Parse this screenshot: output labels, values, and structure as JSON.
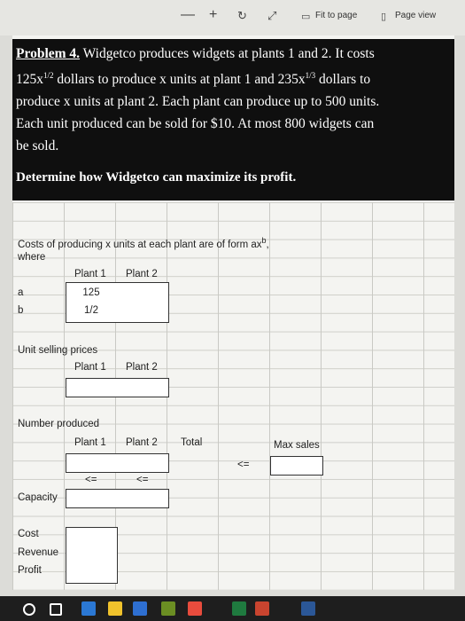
{
  "toolbar": {
    "minus": "—",
    "plus": "+",
    "fit_label": "Fit to page",
    "page_view_label": "Page view"
  },
  "problem": {
    "lead": "Problem 4.",
    "line1": " Widgetco produces widgets at plants 1 and 2. It costs",
    "line2a": "125x",
    "sup1": "1/2",
    "line2b": " dollars to produce x units at plant 1 and 235x",
    "sup2": "1/3",
    "line2c": " dollars to",
    "line3": "produce x units at plant 2. Each plant can produce up to 500 units.",
    "line4": "Each unit produced can be sold for $10. At most 800 widgets can",
    "line5": "be sold.",
    "determine": "Determine how Widgetco can maximize its profit."
  },
  "sheet": {
    "cost_title": "Costs of producing x units at each plant are of form ax",
    "cost_sup": "b",
    "cost_comma": ",",
    "where": "where",
    "plant1": "Plant 1",
    "plant2": "Plant 2",
    "a_label": "a",
    "b_label": "b",
    "a_p1": "125",
    "b_p1": "1/2",
    "unit_selling": "Unit selling prices",
    "number_produced": "Number produced",
    "total": "Total",
    "max_sales": "Max sales",
    "le": "<=",
    "capacity": "Capacity",
    "cost": "Cost",
    "revenue": "Revenue",
    "profit": "Profit"
  }
}
